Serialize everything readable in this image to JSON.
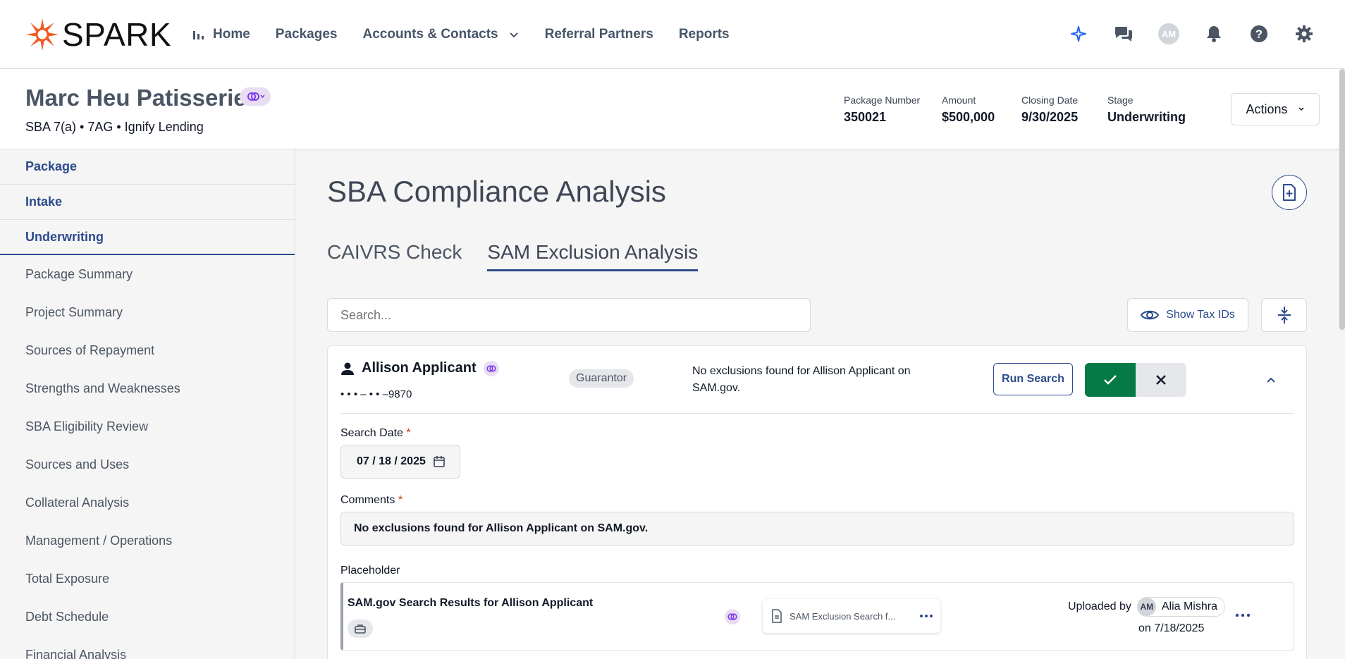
{
  "brand": {
    "name": "SPARK",
    "accent": "#f15a22",
    "primary": "#2c4a8c"
  },
  "nav": {
    "items": [
      {
        "label": "Home",
        "icon": "bar-chart-icon"
      },
      {
        "label": "Packages"
      },
      {
        "label": "Accounts & Contacts",
        "dropdown": true
      },
      {
        "label": "Referral Partners"
      },
      {
        "label": "Reports"
      }
    ],
    "user_initials": "AM"
  },
  "header": {
    "title": "Marc Heu Patisserie",
    "subtitle": "SBA 7(a) • 7AG • Ignify Lending",
    "meta": [
      {
        "label": "Package Number",
        "value": "350021"
      },
      {
        "label": "Amount",
        "value": "$500,000"
      },
      {
        "label": "Closing Date",
        "value": "9/30/2025"
      },
      {
        "label": "Stage",
        "value": "Underwriting"
      }
    ],
    "actions_label": "Actions"
  },
  "sidebar": {
    "sections": [
      "Package",
      "Intake",
      "Underwriting"
    ],
    "items": [
      "Package Summary",
      "Project Summary",
      "Sources of Repayment",
      "Strengths and Weaknesses",
      "SBA Eligibility Review",
      "Sources and Uses",
      "Collateral Analysis",
      "Management / Operations",
      "Total Exposure",
      "Debt Schedule",
      "Financial Analysis"
    ]
  },
  "main": {
    "title": "SBA Compliance Analysis",
    "tabs": [
      {
        "label": "CAIVRS Check",
        "active": false
      },
      {
        "label": "SAM Exclusion Analysis",
        "active": true
      }
    ],
    "search_placeholder": "Search...",
    "show_tax_label": "Show Tax IDs"
  },
  "card": {
    "person_name": "Allison Applicant",
    "tax_id": "• • • – • • –9870",
    "role": "Guarantor",
    "result": "No exclusions found for Allison Applicant on SAM.gov.",
    "run_search_label": "Run Search",
    "search_date_label": "Search Date",
    "required_mark": "*",
    "search_date_value": "07 / 18 / 2025",
    "comments_label": "Comments",
    "comments_value": "No exclusions found for Allison Applicant on SAM.gov.",
    "placeholder_label": "Placeholder",
    "doc": {
      "title": "SAM.gov Search Results for Allison Applicant",
      "file_name": "SAM Exclusion Search f...",
      "uploaded_by_label": "Uploaded by",
      "uploader_initials": "AM",
      "uploader_name": "Alia Mishra",
      "uploaded_on": "on 7/18/2025"
    }
  },
  "colors": {
    "approve": "#067a46",
    "reject_bg": "#e5e7eb",
    "link_chip": "#e9ddf3"
  }
}
